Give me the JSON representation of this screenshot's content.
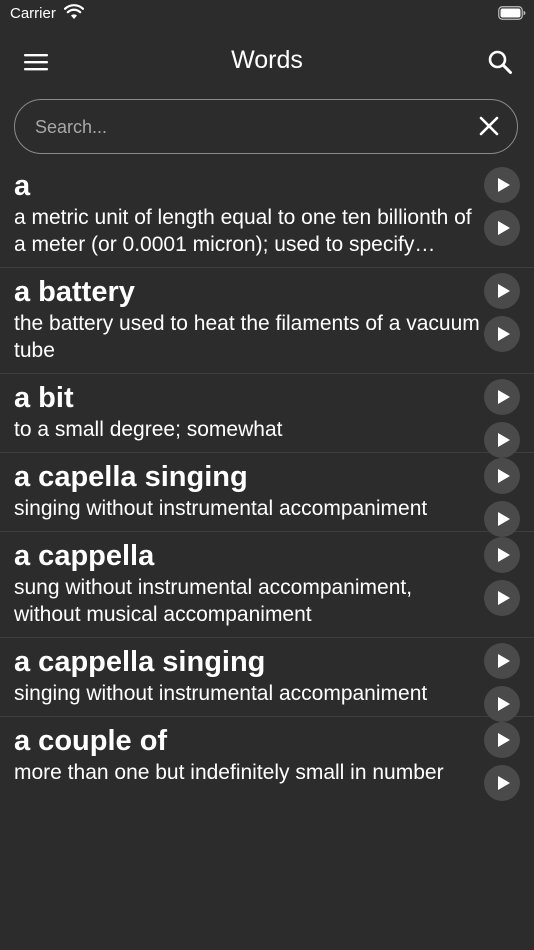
{
  "status_bar": {
    "carrier": "Carrier"
  },
  "nav": {
    "title": "Words"
  },
  "search": {
    "placeholder": "Search...",
    "value": ""
  },
  "words": [
    {
      "word": "a",
      "definition": "a metric unit of length equal to one ten billionth of a meter (or 0.0001 micron); used to specify wavelengths of electromagnetic radiation"
    },
    {
      "word": "a battery",
      "definition": "the battery used to heat the filaments of a vacuum tube"
    },
    {
      "word": "a bit",
      "definition": "to a small degree; somewhat"
    },
    {
      "word": "a capella singing",
      "definition": "singing without instrumental accompaniment"
    },
    {
      "word": "a cappella",
      "definition": "sung without instrumental accompaniment, without musical accompaniment"
    },
    {
      "word": "a cappella singing",
      "definition": "singing without instrumental accompaniment"
    },
    {
      "word": "a couple of",
      "definition": "more than one but indefinitely small in number"
    }
  ],
  "icons": {
    "menu": "menu-icon",
    "search": "search-icon",
    "clear": "close-icon",
    "play": "play-icon",
    "wifi": "wifi-icon",
    "battery": "battery-icon"
  },
  "colors": {
    "background": "#2c2c2c",
    "play_button_bg": "#4a4a4a",
    "text": "#ffffff",
    "placeholder": "#a8a8a8"
  }
}
